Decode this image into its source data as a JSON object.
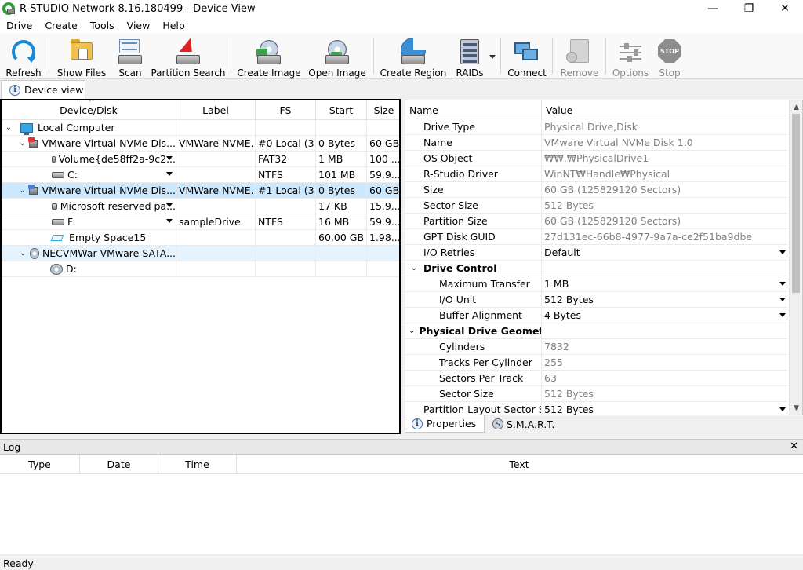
{
  "window": {
    "title": "R-STUDIO Network 8.16.180499 - Device View",
    "controls": {
      "minimize": "—",
      "maximize": "❐",
      "close": "✕"
    }
  },
  "menu": [
    "Drive",
    "Create",
    "Tools",
    "View",
    "Help"
  ],
  "toolbar": {
    "refresh": "Refresh",
    "show_files": "Show Files",
    "scan": "Scan",
    "partition_search": "Partition Search",
    "create_image": "Create Image",
    "open_image": "Open Image",
    "create_region": "Create Region",
    "raids": "RAIDs",
    "connect": "Connect",
    "remove": "Remove",
    "options": "Options",
    "stop": "Stop",
    "stop_icon_text": "STOP"
  },
  "tabs": {
    "device_view": "Device view"
  },
  "device_grid": {
    "columns": [
      "Device/Disk",
      "Label",
      "FS",
      "Start",
      "Size"
    ],
    "rows": [
      {
        "name": "Local Computer",
        "label": "",
        "fs": "",
        "start": "",
        "size": "",
        "expander": "⌄",
        "icon": "computer-icon"
      },
      {
        "name": "VMware Virtual NVMe Dis...",
        "label": "VMWare NVME...",
        "fs": "#0 Local (3...",
        "start": "0 Bytes",
        "size": "60 GB",
        "expander": "⌄",
        "icon": "nvme-disk-icon"
      },
      {
        "name": "Volume{de58ff2a-9c2...",
        "label": "",
        "fs": "FAT32",
        "start": "1 MB",
        "size": "100 ...",
        "icon": "volume-icon"
      },
      {
        "name": "C:",
        "label": "",
        "fs": "NTFS",
        "start": "101 MB",
        "size": "59.9...",
        "icon": "volume-icon"
      },
      {
        "name": "VMware Virtual NVMe Dis...",
        "label": "VMWare NVME...",
        "fs": "#1 Local (3...",
        "start": "0 Bytes",
        "size": "60 GB",
        "expander": "⌄",
        "icon": "nvme-disk-icon"
      },
      {
        "name": "Microsoft reserved pa...",
        "label": "",
        "fs": "",
        "start": "17 KB",
        "size": "15.9...",
        "icon": "volume-icon"
      },
      {
        "name": "F:",
        "label": "sampleDrive",
        "fs": "NTFS",
        "start": "16 MB",
        "size": "59.9...",
        "icon": "volume-icon"
      },
      {
        "name": "Empty Space15",
        "label": "",
        "fs": "",
        "start": "60.00 GB",
        "size": "1.98...",
        "icon": "empty-space-icon"
      },
      {
        "name": "NECVMWar VMware SATA...",
        "label": "",
        "fs": "",
        "start": "",
        "size": "",
        "expander": "⌄",
        "icon": "optical-drive-icon"
      },
      {
        "name": "D:",
        "label": "",
        "fs": "",
        "start": "",
        "size": "",
        "icon": "optical-volume-icon"
      }
    ]
  },
  "properties": {
    "columns": [
      "Name",
      "Value"
    ],
    "rows": [
      {
        "name": "Drive Type",
        "value": "Physical Drive,Disk"
      },
      {
        "name": "Name",
        "value": "VMware Virtual NVMe Disk 1.0"
      },
      {
        "name": "OS Object",
        "value": "₩₩.₩PhysicalDrive1"
      },
      {
        "name": "R-Studio Driver",
        "value": "WinNT₩Handle₩Physical"
      },
      {
        "name": "Size",
        "value": "60 GB (125829120 Sectors)"
      },
      {
        "name": "Sector Size",
        "value": "512 Bytes"
      },
      {
        "name": "Partition Size",
        "value": "60 GB (125829120 Sectors)"
      },
      {
        "name": "GPT Disk GUID",
        "value": "27d131ec-66b8-4977-9a7a-ce2f51ba9dbe"
      },
      {
        "name": "I/O Retries",
        "value": "Default"
      },
      {
        "name": "Drive Control",
        "value": ""
      },
      {
        "name": "Maximum Transfer",
        "value": "1 MB"
      },
      {
        "name": "I/O Unit",
        "value": "512 Bytes"
      },
      {
        "name": "Buffer Alignment",
        "value": "4 Bytes"
      },
      {
        "name": "Physical Drive Geometry",
        "value": ""
      },
      {
        "name": "Cylinders",
        "value": "7832"
      },
      {
        "name": "Tracks Per Cylinder",
        "value": "255"
      },
      {
        "name": "Sectors Per Track",
        "value": "63"
      },
      {
        "name": "Sector Size",
        "value": "512 Bytes"
      },
      {
        "name": "Partition Layout Sector Size",
        "value": "512 Bytes"
      }
    ],
    "group_expander": "⌄"
  },
  "right_tabs": {
    "properties": "Properties",
    "smart": "S.M.A.R.T.",
    "smart_icon_text": "S"
  },
  "log": {
    "title": "Log",
    "close": "✕",
    "columns": [
      "Type",
      "Date",
      "Time",
      "Text"
    ]
  },
  "status": {
    "text": "Ready"
  },
  "glyphs": {
    "info": "i",
    "scroll_up": "▲",
    "scroll_down": "▼",
    "sort": "^"
  }
}
